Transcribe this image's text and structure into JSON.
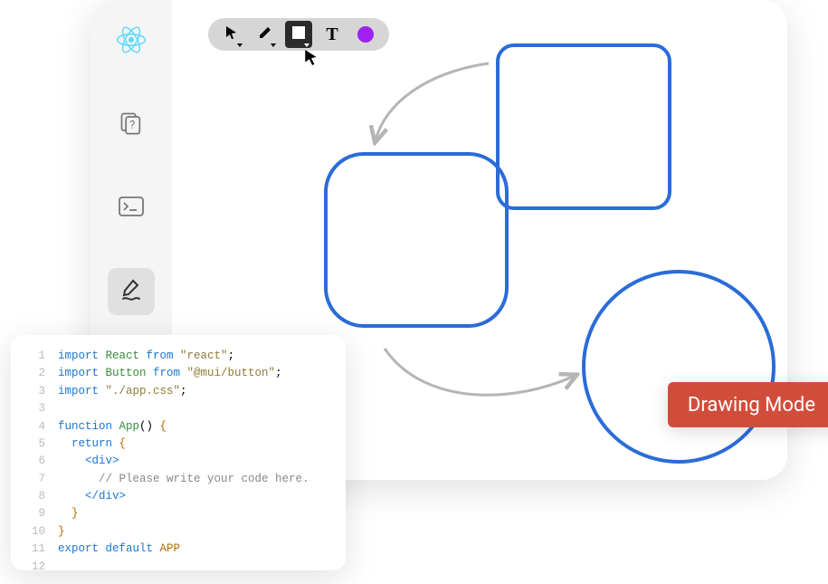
{
  "sidebar": {
    "items": [
      {
        "name": "react-logo"
      },
      {
        "name": "help"
      },
      {
        "name": "terminal"
      },
      {
        "name": "draw",
        "active": true
      }
    ]
  },
  "toolbar": {
    "tools": [
      {
        "name": "cursor"
      },
      {
        "name": "pencil"
      },
      {
        "name": "shape",
        "active": true
      },
      {
        "name": "text",
        "glyph": "T"
      },
      {
        "name": "color",
        "color": "#a020f0"
      }
    ]
  },
  "badge": {
    "label": "Drawing Mode"
  },
  "shapes": {
    "stroke": "#2a6cd8"
  },
  "code": {
    "lines": [
      {
        "n": "1",
        "seg": [
          {
            "t": "import ",
            "c": "c-kw"
          },
          {
            "t": "React",
            "c": "c-type"
          },
          {
            "t": " from ",
            "c": "c-kw"
          },
          {
            "t": "\"react\"",
            "c": "c-str"
          },
          {
            "t": ";",
            "c": ""
          }
        ]
      },
      {
        "n": "2",
        "seg": [
          {
            "t": "import ",
            "c": "c-kw"
          },
          {
            "t": "Button",
            "c": "c-type"
          },
          {
            "t": " from ",
            "c": "c-kw"
          },
          {
            "t": "\"@mui/button\"",
            "c": "c-str"
          },
          {
            "t": ";",
            "c": ""
          }
        ]
      },
      {
        "n": "3",
        "seg": [
          {
            "t": "import ",
            "c": "c-kw"
          },
          {
            "t": "\"./app.css\"",
            "c": "c-str"
          },
          {
            "t": ";",
            "c": ""
          }
        ]
      },
      {
        "n": "3",
        "seg": [
          {
            "t": "",
            "c": ""
          }
        ]
      },
      {
        "n": "4",
        "seg": [
          {
            "t": "function ",
            "c": "c-kw"
          },
          {
            "t": "App",
            "c": "c-type"
          },
          {
            "t": "()",
            "c": ""
          },
          {
            "t": " {",
            "c": "c-brace"
          }
        ]
      },
      {
        "n": "5",
        "seg": [
          {
            "t": "  return ",
            "c": "c-kw"
          },
          {
            "t": "{",
            "c": "c-brace"
          }
        ]
      },
      {
        "n": "6",
        "seg": [
          {
            "t": "    <div>",
            "c": "c-tag"
          }
        ]
      },
      {
        "n": "7",
        "seg": [
          {
            "t": "      // Please write your code here.",
            "c": "c-comment"
          }
        ]
      },
      {
        "n": "8",
        "seg": [
          {
            "t": "    </div>",
            "c": "c-tag"
          }
        ]
      },
      {
        "n": "9",
        "seg": [
          {
            "t": "  }",
            "c": "c-brace"
          }
        ]
      },
      {
        "n": "10",
        "seg": [
          {
            "t": "}",
            "c": "c-brace"
          }
        ]
      },
      {
        "n": "11",
        "seg": [
          {
            "t": "export default ",
            "c": "c-kw"
          },
          {
            "t": "APP",
            "c": "c-fn"
          }
        ]
      },
      {
        "n": "12",
        "seg": [
          {
            "t": "",
            "c": ""
          }
        ]
      }
    ]
  }
}
